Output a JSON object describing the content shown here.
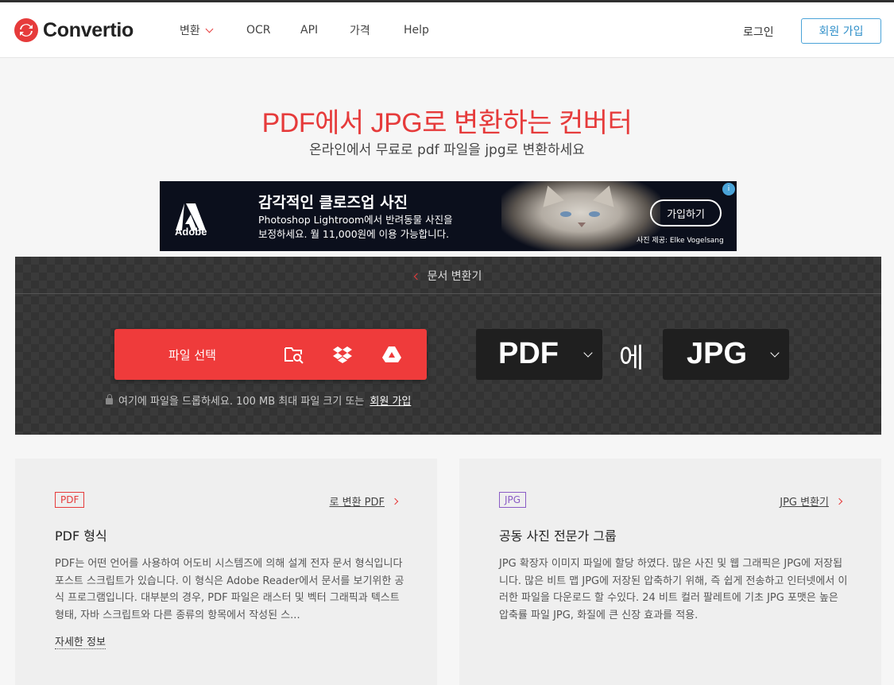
{
  "header": {
    "logo_text": "Convertio",
    "nav": [
      "변환",
      "OCR",
      "API",
      "가격",
      "Help"
    ],
    "login_label": "로그인",
    "signup_label": "회원 가입"
  },
  "hero": {
    "title": "PDF에서 JPG로 변환하는 컨버터",
    "subtitle": "온라인에서 무료로 pdf 파일을 jpg로 변환하세요"
  },
  "ad": {
    "brand": "Adobe",
    "headline": "감각적인 클로즈업 사진",
    "body_line1": "Photoshop Lightroom에서 반려동물 사진을",
    "body_line2": "보정하세요. 월 11,000원에 이용 가능합니다.",
    "cta": "가입하기",
    "credit": "사진 제공: Elke Vogelsang"
  },
  "converter": {
    "back_label": "문서 변환기",
    "choose_label": "파일 선택",
    "drop_note": "여기에 파일을 드롭하세요. 100 MB 최대 파일 크기 또는",
    "drop_link": "회원 가입",
    "from_format": "PDF",
    "to_word": "에",
    "to_format": "JPG"
  },
  "cards": [
    {
      "tag": "PDF",
      "link": "로 변환 PDF",
      "title": "PDF 형식",
      "body": "PDF는 어떤 언어를 사용하여 어도비 시스템즈에 의해 설계 전자 문서 형식입니다 포스트 스크립트가 있습니다. 이 형식은 Adobe Reader에서 문서를 보기위한 공식 프로그램입니다. 대부분의 경우, PDF 파일은 래스터 및 벡터 그래픽과 텍스트 형태, 자바 스크립트와 다른 종류의 항목에서 작성된 스...",
      "more": "자세한 정보"
    },
    {
      "tag": "JPG",
      "link": "JPG 변환기",
      "title": "공동 사진 전문가 그룹",
      "body": "JPG 확장자 이미지 파일에 할당 하였다. 많은 사진 및 웹 그래픽은 JPG에 저장됩니다. 많은 비트 맵 JPG에 저장된 압축하기 위해, 즉 쉽게 전송하고 인터넷에서 이러한 파일을 다운로드 할 수있다. 24 비트 컬러 팔레트에 기초 JPG 포맷은 높은 압축률 파일 JPG, 화질에 큰 신장 효과를 적용."
    }
  ],
  "colors": {
    "accent": "#e63b3b",
    "link_blue": "#2f8fc9",
    "jpg_tag": "#8a5cc5"
  }
}
